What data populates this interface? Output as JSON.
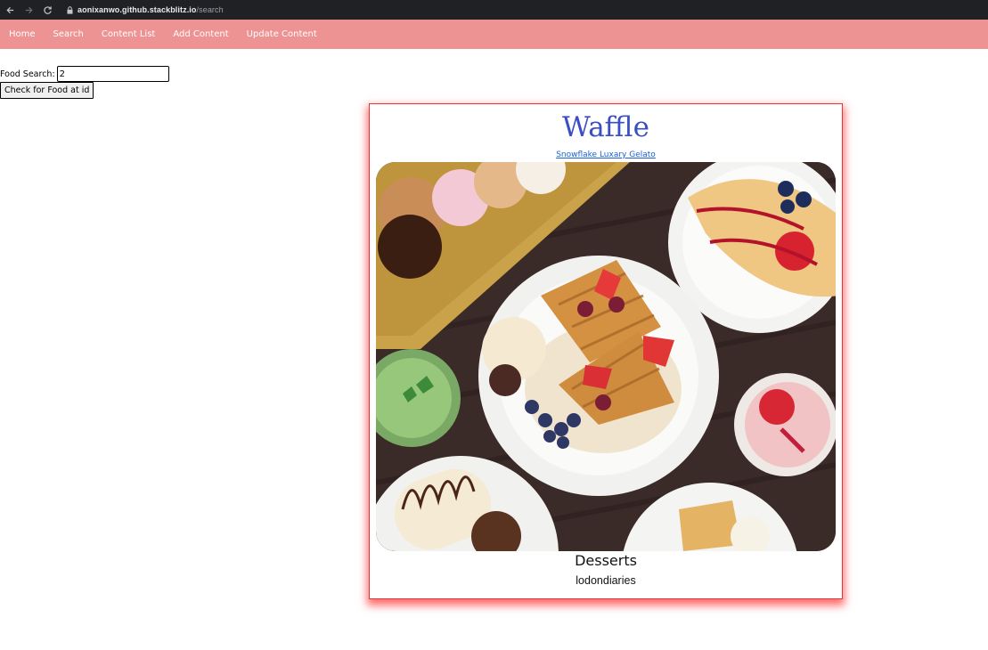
{
  "browser": {
    "url_host": "aonixanwo.github.stackblitz.io",
    "url_path": "/search"
  },
  "nav": {
    "items": [
      {
        "label": "Home"
      },
      {
        "label": "Search"
      },
      {
        "label": "Content List"
      },
      {
        "label": "Add Content"
      },
      {
        "label": "Update Content"
      }
    ],
    "background": "#ee9393"
  },
  "search": {
    "label": "Food Search:",
    "value": "2",
    "button_label": "Check for Food at id"
  },
  "card": {
    "title": "Waffle",
    "link_text": "Snowflake Luxary Gelato",
    "image_icon": "food-photo",
    "category": "Desserts",
    "author": "lodondiaries",
    "title_color": "#3b4fc4",
    "border_color": "#e23a3a"
  }
}
